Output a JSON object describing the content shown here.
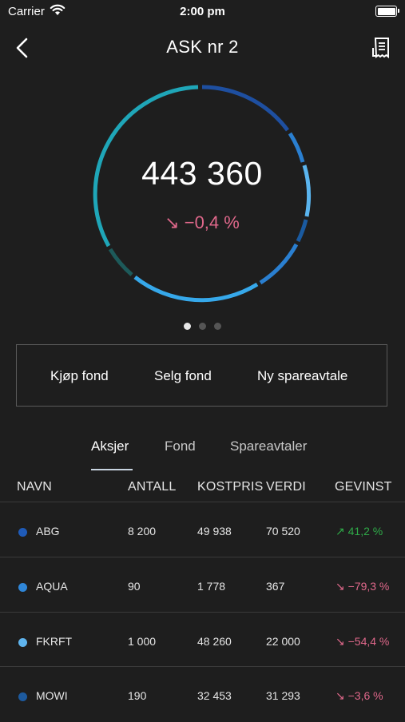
{
  "status_bar": {
    "carrier": "Carrier",
    "time": "2:00 pm"
  },
  "header": {
    "title": "ASK nr 2"
  },
  "summary": {
    "total": "443 360",
    "change": "↘ −0,4 %"
  },
  "actions": {
    "buy": "Kjøp fond",
    "sell": "Selg fond",
    "new_plan": "Ny spareavtale"
  },
  "tabs": [
    {
      "label": "Aksjer"
    },
    {
      "label": "Fond"
    },
    {
      "label": "Spareavtaler"
    }
  ],
  "table": {
    "headers": {
      "name": "NAVN",
      "quantity": "ANTALL",
      "cost": "KOSTPRIS",
      "value": "VERDI",
      "gain": "GEVINST"
    },
    "rows": [
      {
        "name": "ABG",
        "quantity": "8 200",
        "cost": "49 938",
        "value": "70 520",
        "gain": "↗ 41,2 %",
        "trend": "up",
        "color": "#1f5bb8"
      },
      {
        "name": "AQUA",
        "quantity": "90",
        "cost": "1 778",
        "value": "367",
        "gain": "↘ −79,3 %",
        "trend": "down",
        "color": "#2f86d8"
      },
      {
        "name": "FKRFT",
        "quantity": "1 000",
        "cost": "48 260",
        "value": "22 000",
        "gain": "↘ −54,4 %",
        "trend": "down",
        "color": "#5fb4ee"
      },
      {
        "name": "MOWI",
        "quantity": "190",
        "cost": "32 453",
        "value": "31 293",
        "gain": "↘ −3,6 %",
        "trend": "down",
        "color": "#1d5a9e"
      }
    ]
  },
  "colors": {
    "background": "#1e1e1e",
    "negative": "#e0688b",
    "positive": "#2faa48"
  }
}
